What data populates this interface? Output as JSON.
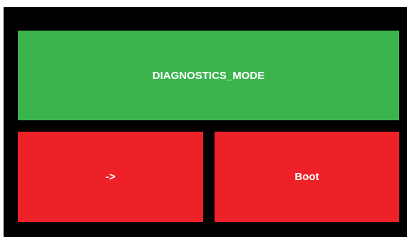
{
  "buttons": {
    "mode_label": "DIAGNOSTICS_MODE",
    "arrow_label": "->",
    "boot_label": "Boot"
  },
  "colors": {
    "background": "#000000",
    "mode_button": "#3bb44e",
    "action_buttons": "#ed2127",
    "text": "#ffffff"
  }
}
